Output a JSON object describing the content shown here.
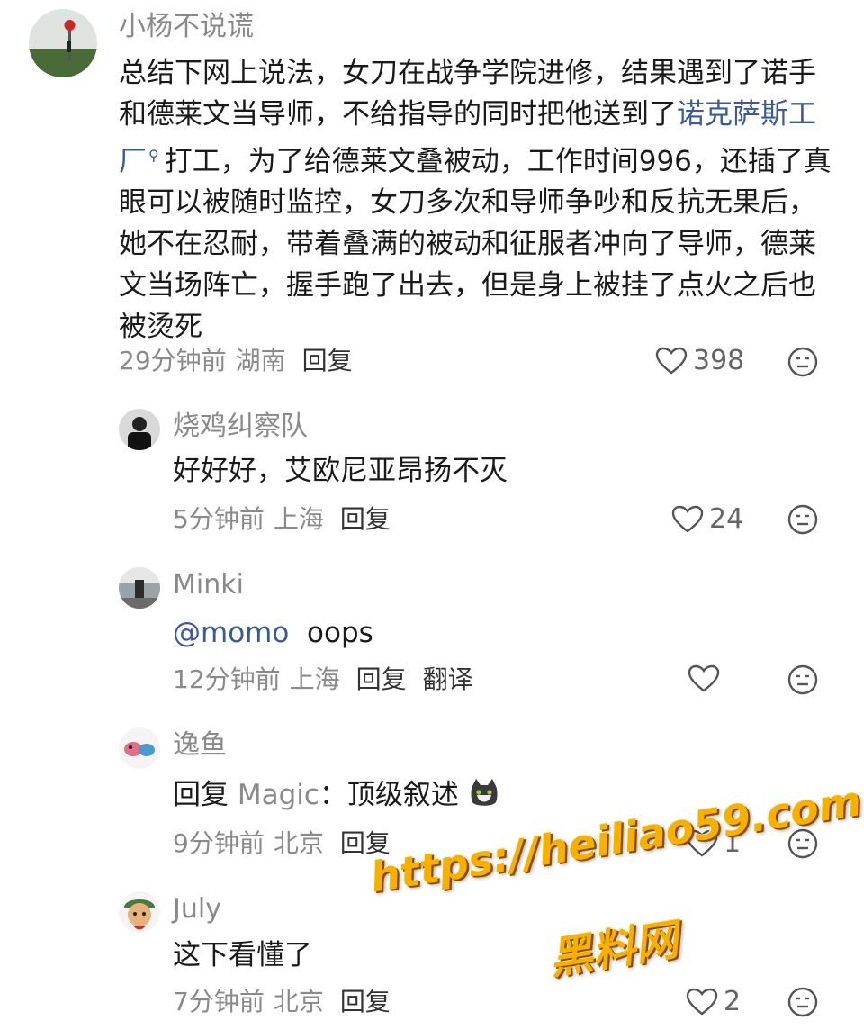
{
  "comments": [
    {
      "user": "小杨不说谎",
      "text_parts": {
        "a": "总结下网上说法，女刀在战争学院进修，结果遇到了诺手和德莱文当导师，不给指导的同时把他送到了",
        "link": "诺克萨斯工厂",
        "b": "打工，为了给德莱文叠被动，工作时间996，还插了真眼可以被随时监控，女刀多次和导师争吵和反抗无果后，她不在忍耐，带着叠满的被动和征服者冲向了导师，德莱文当场阵亡，握手跑了出去，但是身上被挂了点火之后也被烫死"
      },
      "time": "29分钟前",
      "location": "湖南",
      "reply_label": "回复",
      "likes": "398"
    },
    {
      "user": "烧鸡纠察队",
      "text": "好好好，艾欧尼亚昂扬不灭",
      "time": "5分钟前",
      "location": "上海",
      "reply_label": "回复",
      "likes": "24"
    },
    {
      "user": "Minki",
      "mention": "@momo",
      "text": "oops",
      "time": "12分钟前",
      "location": "上海",
      "reply_label": "回复",
      "translate_label": "翻译"
    },
    {
      "user": "逸鱼",
      "reply_prefix": "回复",
      "reply_to": "Magic",
      "text": "：顶级叙述",
      "time": "9分钟前",
      "location": "北京",
      "reply_label": "回复",
      "likes": "1"
    },
    {
      "user": "July",
      "text": "这下看懂了",
      "time": "7分钟前",
      "location": "北京",
      "reply_label": "回复",
      "likes": "2"
    }
  ],
  "watermark": {
    "url": "https://heiliao59.com",
    "name": "黑料网"
  },
  "colors": {
    "muted": "#8a8a8a",
    "link": "#3a5a9a",
    "watermark": "#f5b000"
  }
}
